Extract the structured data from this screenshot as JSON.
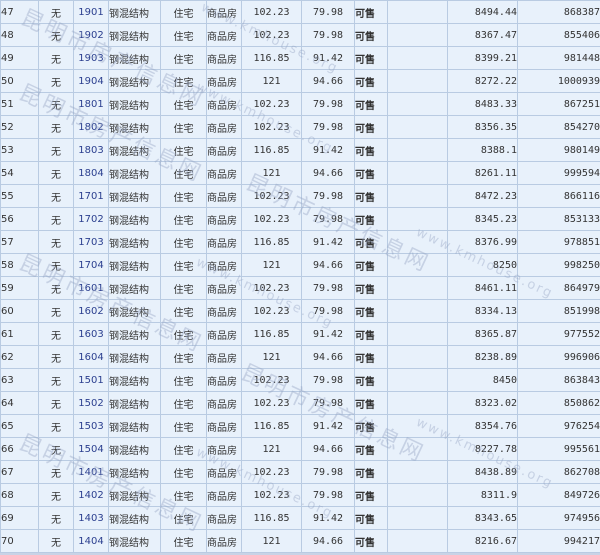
{
  "rows": [
    {
      "idx": "47",
      "none": "无",
      "room": "1901",
      "structure": "钢混结构",
      "use": "住宅",
      "type": "商品房",
      "area": "102.23",
      "inner": "79.98",
      "status": "可售",
      "price": "8494.44",
      "total": "868387"
    },
    {
      "idx": "48",
      "none": "无",
      "room": "1902",
      "structure": "钢混结构",
      "use": "住宅",
      "type": "商品房",
      "area": "102.23",
      "inner": "79.98",
      "status": "可售",
      "price": "8367.47",
      "total": "855406"
    },
    {
      "idx": "49",
      "none": "无",
      "room": "1903",
      "structure": "钢混结构",
      "use": "住宅",
      "type": "商品房",
      "area": "116.85",
      "inner": "91.42",
      "status": "可售",
      "price": "8399.21",
      "total": "981448"
    },
    {
      "idx": "50",
      "none": "无",
      "room": "1904",
      "structure": "钢混结构",
      "use": "住宅",
      "type": "商品房",
      "area": "121",
      "inner": "94.66",
      "status": "可售",
      "price": "8272.22",
      "total": "1000939"
    },
    {
      "idx": "51",
      "none": "无",
      "room": "1801",
      "structure": "钢混结构",
      "use": "住宅",
      "type": "商品房",
      "area": "102.23",
      "inner": "79.98",
      "status": "可售",
      "price": "8483.33",
      "total": "867251"
    },
    {
      "idx": "52",
      "none": "无",
      "room": "1802",
      "structure": "钢混结构",
      "use": "住宅",
      "type": "商品房",
      "area": "102.23",
      "inner": "79.98",
      "status": "可售",
      "price": "8356.35",
      "total": "854270"
    },
    {
      "idx": "53",
      "none": "无",
      "room": "1803",
      "structure": "钢混结构",
      "use": "住宅",
      "type": "商品房",
      "area": "116.85",
      "inner": "91.42",
      "status": "可售",
      "price": "8388.1",
      "total": "980149"
    },
    {
      "idx": "54",
      "none": "无",
      "room": "1804",
      "structure": "钢混结构",
      "use": "住宅",
      "type": "商品房",
      "area": "121",
      "inner": "94.66",
      "status": "可售",
      "price": "8261.11",
      "total": "999594"
    },
    {
      "idx": "55",
      "none": "无",
      "room": "1701",
      "structure": "钢混结构",
      "use": "住宅",
      "type": "商品房",
      "area": "102.23",
      "inner": "79.98",
      "status": "可售",
      "price": "8472.23",
      "total": "866116"
    },
    {
      "idx": "56",
      "none": "无",
      "room": "1702",
      "structure": "钢混结构",
      "use": "住宅",
      "type": "商品房",
      "area": "102.23",
      "inner": "79.98",
      "status": "可售",
      "price": "8345.23",
      "total": "853133"
    },
    {
      "idx": "57",
      "none": "无",
      "room": "1703",
      "structure": "钢混结构",
      "use": "住宅",
      "type": "商品房",
      "area": "116.85",
      "inner": "91.42",
      "status": "可售",
      "price": "8376.99",
      "total": "978851"
    },
    {
      "idx": "58",
      "none": "无",
      "room": "1704",
      "structure": "钢混结构",
      "use": "住宅",
      "type": "商品房",
      "area": "121",
      "inner": "94.66",
      "status": "可售",
      "price": "8250",
      "total": "998250"
    },
    {
      "idx": "59",
      "none": "无",
      "room": "1601",
      "structure": "钢混结构",
      "use": "住宅",
      "type": "商品房",
      "area": "102.23",
      "inner": "79.98",
      "status": "可售",
      "price": "8461.11",
      "total": "864979"
    },
    {
      "idx": "60",
      "none": "无",
      "room": "1602",
      "structure": "钢混结构",
      "use": "住宅",
      "type": "商品房",
      "area": "102.23",
      "inner": "79.98",
      "status": "可售",
      "price": "8334.13",
      "total": "851998"
    },
    {
      "idx": "61",
      "none": "无",
      "room": "1603",
      "structure": "钢混结构",
      "use": "住宅",
      "type": "商品房",
      "area": "116.85",
      "inner": "91.42",
      "status": "可售",
      "price": "8365.87",
      "total": "977552"
    },
    {
      "idx": "62",
      "none": "无",
      "room": "1604",
      "structure": "钢混结构",
      "use": "住宅",
      "type": "商品房",
      "area": "121",
      "inner": "94.66",
      "status": "可售",
      "price": "8238.89",
      "total": "996906"
    },
    {
      "idx": "63",
      "none": "无",
      "room": "1501",
      "structure": "钢混结构",
      "use": "住宅",
      "type": "商品房",
      "area": "102.23",
      "inner": "79.98",
      "status": "可售",
      "price": "8450",
      "total": "863843"
    },
    {
      "idx": "64",
      "none": "无",
      "room": "1502",
      "structure": "钢混结构",
      "use": "住宅",
      "type": "商品房",
      "area": "102.23",
      "inner": "79.98",
      "status": "可售",
      "price": "8323.02",
      "total": "850862"
    },
    {
      "idx": "65",
      "none": "无",
      "room": "1503",
      "structure": "钢混结构",
      "use": "住宅",
      "type": "商品房",
      "area": "116.85",
      "inner": "91.42",
      "status": "可售",
      "price": "8354.76",
      "total": "976254"
    },
    {
      "idx": "66",
      "none": "无",
      "room": "1504",
      "structure": "钢混结构",
      "use": "住宅",
      "type": "商品房",
      "area": "121",
      "inner": "94.66",
      "status": "可售",
      "price": "8227.78",
      "total": "995561"
    },
    {
      "idx": "67",
      "none": "无",
      "room": "1401",
      "structure": "钢混结构",
      "use": "住宅",
      "type": "商品房",
      "area": "102.23",
      "inner": "79.98",
      "status": "可售",
      "price": "8438.89",
      "total": "862708"
    },
    {
      "idx": "68",
      "none": "无",
      "room": "1402",
      "structure": "钢混结构",
      "use": "住宅",
      "type": "商品房",
      "area": "102.23",
      "inner": "79.98",
      "status": "可售",
      "price": "8311.9",
      "total": "849726"
    },
    {
      "idx": "69",
      "none": "无",
      "room": "1403",
      "structure": "钢混结构",
      "use": "住宅",
      "type": "商品房",
      "area": "116.85",
      "inner": "91.42",
      "status": "可售",
      "price": "8343.65",
      "total": "974956"
    },
    {
      "idx": "70",
      "none": "无",
      "room": "1404",
      "structure": "钢混结构",
      "use": "住宅",
      "type": "商品房",
      "area": "121",
      "inner": "94.66",
      "status": "可售",
      "price": "8216.67",
      "total": "994217"
    }
  ],
  "watermark": {
    "cn": "昆明市房产信息网",
    "en": "www.kmhouse.org"
  },
  "colors": {
    "status_available": "#1a7a1a",
    "room_link": "#2b3f8f",
    "row_background": "#e8f1fb",
    "grid_border": "#b9cbe2"
  }
}
